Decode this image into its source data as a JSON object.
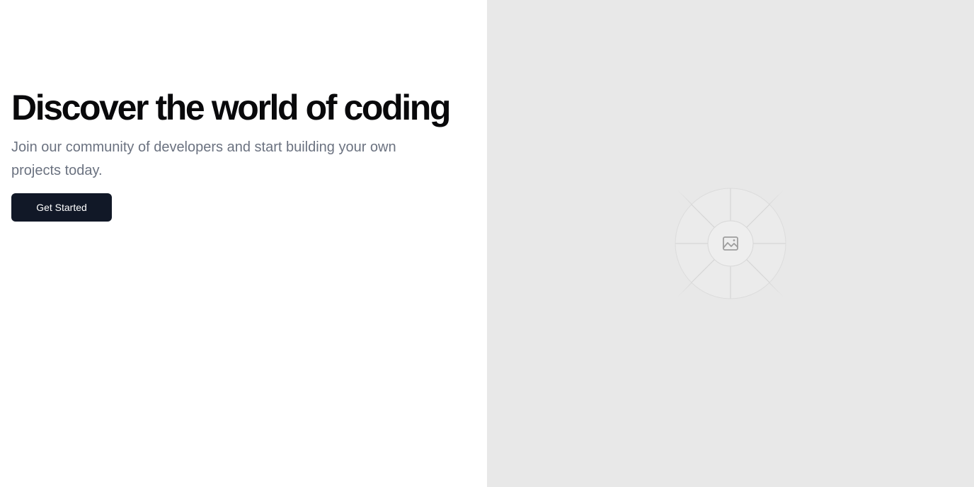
{
  "hero": {
    "title": "Discover the world of coding",
    "subtitle": "Join our community of developers and start building your own projects today.",
    "cta_label": "Get Started"
  },
  "media": {
    "icon": "image-placeholder-icon"
  },
  "colors": {
    "title": "#09090b",
    "subtitle": "#6b7280",
    "button_bg": "#111827",
    "button_text": "#ffffff",
    "media_bg": "#e8e8e8"
  }
}
